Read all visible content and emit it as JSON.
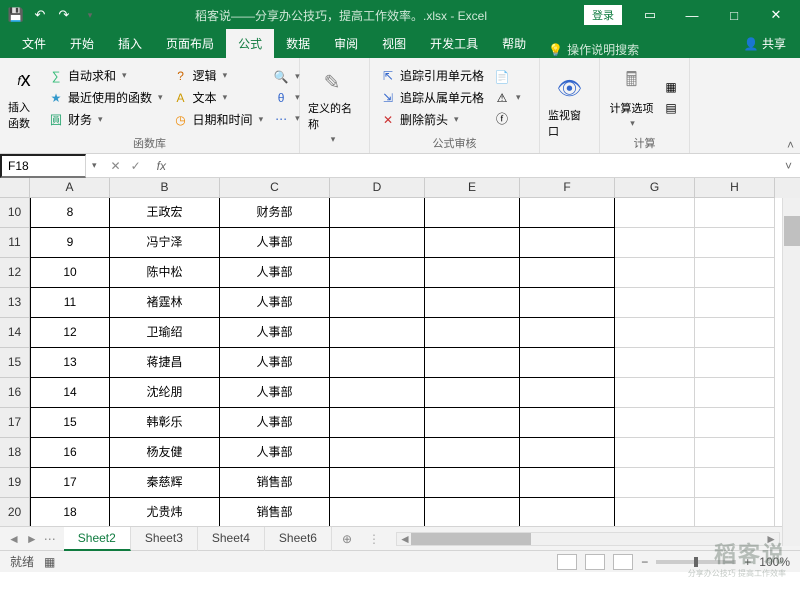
{
  "title": "稻客说——分享办公技巧，提高工作效率。.xlsx - Excel",
  "login": "登录",
  "tabs": [
    "文件",
    "开始",
    "插入",
    "页面布局",
    "公式",
    "数据",
    "审阅",
    "视图",
    "开发工具",
    "帮助"
  ],
  "activeTab": 4,
  "tellMe": "操作说明搜索",
  "share": "共享",
  "ribbon": {
    "g0": {
      "btn": "插入函数",
      "label": "函数库"
    },
    "g0items": [
      "自动求和",
      "最近使用的函数",
      "财务",
      "逻辑",
      "文本",
      "日期和时间"
    ],
    "g1": {
      "btn": "定义的名称"
    },
    "g2items": [
      "追踪引用单元格",
      "追踪从属单元格",
      "删除箭头"
    ],
    "g2label": "公式审核",
    "g3": {
      "btn": "监视窗口"
    },
    "g4": {
      "btn": "计算选项",
      "label": "计算"
    }
  },
  "nameBox": "F18",
  "cols": [
    {
      "name": "A",
      "w": 80
    },
    {
      "name": "B",
      "w": 110
    },
    {
      "name": "C",
      "w": 110
    },
    {
      "name": "D",
      "w": 95
    },
    {
      "name": "E",
      "w": 95
    },
    {
      "name": "F",
      "w": 95
    },
    {
      "name": "G",
      "w": 80
    },
    {
      "name": "H",
      "w": 80
    }
  ],
  "rows": [
    {
      "n": "10",
      "a": "8",
      "b": "王政宏",
      "c": "财务部"
    },
    {
      "n": "11",
      "a": "9",
      "b": "冯宁泽",
      "c": "人事部"
    },
    {
      "n": "12",
      "a": "10",
      "b": "陈中松",
      "c": "人事部"
    },
    {
      "n": "13",
      "a": "11",
      "b": "褚霆林",
      "c": "人事部"
    },
    {
      "n": "14",
      "a": "12",
      "b": "卫瑜绍",
      "c": "人事部"
    },
    {
      "n": "15",
      "a": "13",
      "b": "蒋捷昌",
      "c": "人事部"
    },
    {
      "n": "16",
      "a": "14",
      "b": "沈纶朋",
      "c": "人事部"
    },
    {
      "n": "17",
      "a": "15",
      "b": "韩彰乐",
      "c": "人事部"
    },
    {
      "n": "18",
      "a": "16",
      "b": "杨友健",
      "c": "人事部"
    },
    {
      "n": "19",
      "a": "17",
      "b": "秦慈辉",
      "c": "销售部"
    },
    {
      "n": "20",
      "a": "18",
      "b": "尤贵炜",
      "c": "销售部"
    }
  ],
  "sheets": [
    "Sheet2",
    "Sheet3",
    "Sheet4",
    "Sheet6"
  ],
  "activeSheet": 0,
  "status": "就绪",
  "zoom": "100%",
  "watermark": "稻客说",
  "watermarkSub": "分享办公技巧 提高工作效率"
}
